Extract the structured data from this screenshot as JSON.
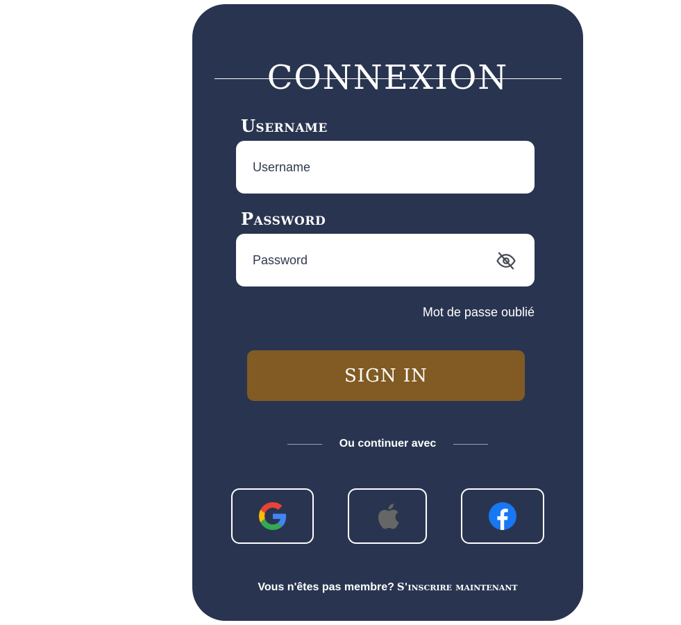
{
  "login": {
    "title": "CONNEXION",
    "username_label": "Username",
    "username_placeholder": "Username",
    "password_label": "Password",
    "password_placeholder": "Password",
    "password_toggle_icon": "eye-off-icon",
    "forgot_password": "Mot de passe oublié",
    "sign_in_label": "SIGN IN",
    "divider_text": "Ou continuer avec",
    "social": [
      {
        "provider": "Google",
        "icon": "google-icon"
      },
      {
        "provider": "Apple",
        "icon": "apple-icon"
      },
      {
        "provider": "Facebook",
        "icon": "facebook-icon"
      }
    ],
    "footer_question": "Vous n'êtes pas membre?",
    "footer_link": "S'inscrire maintenant"
  },
  "colors": {
    "card_background": "#293550",
    "sign_in_button": "#815b23",
    "text": "#ffffff",
    "facebook_blue": "#1877f2",
    "apple_grey": "#666666"
  }
}
